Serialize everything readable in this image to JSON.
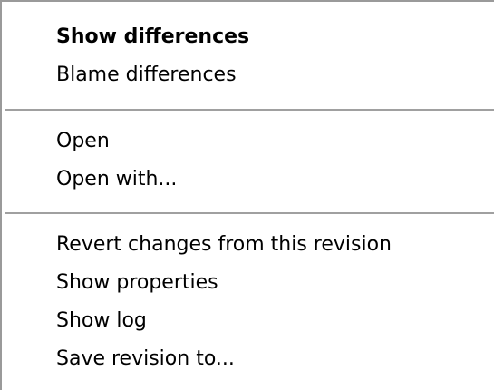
{
  "menu": {
    "items": [
      {
        "label": "Show differences",
        "default": true
      },
      {
        "label": "Blame differences"
      },
      {
        "label": "Open"
      },
      {
        "label": "Open with..."
      },
      {
        "label": "Revert changes from this revision"
      },
      {
        "label": "Show properties"
      },
      {
        "label": "Show log"
      },
      {
        "label": "Save revision to..."
      }
    ]
  }
}
